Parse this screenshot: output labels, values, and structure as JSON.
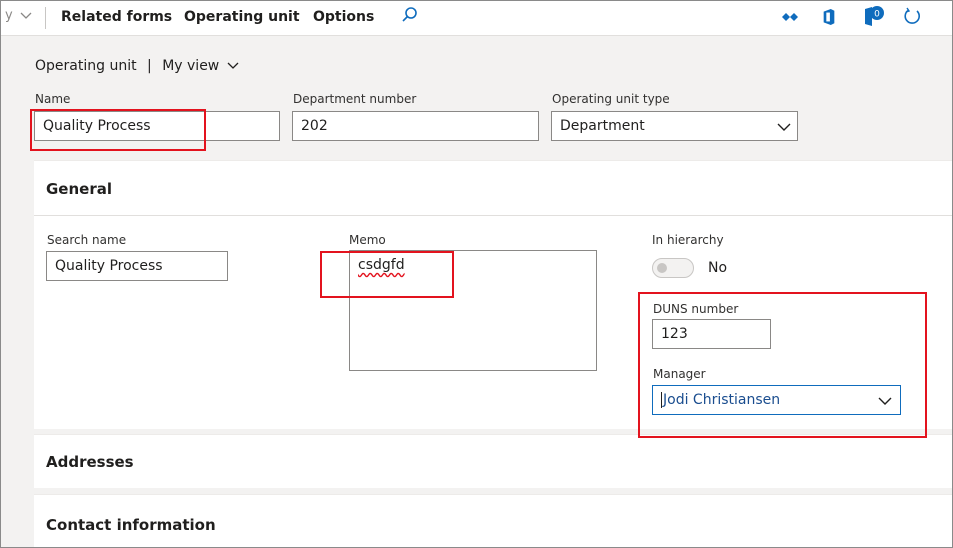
{
  "toolbar": {
    "cut_glyph": "y",
    "items": [
      "Related forms",
      "Operating unit",
      "Options"
    ],
    "icons": [
      "chevron-down-icon",
      "search-icon",
      "diamond-icon",
      "office-icon",
      "badge-icon",
      "refresh-icon"
    ],
    "badge_count": "0"
  },
  "header": {
    "title": "Operating unit",
    "separator": "|",
    "view": "My view"
  },
  "fields": {
    "name": {
      "label": "Name",
      "value": "Quality Process"
    },
    "department_number": {
      "label": "Department number",
      "value": "202"
    },
    "operating_unit_type": {
      "label": "Operating unit type",
      "value": "Department"
    }
  },
  "general": {
    "title": "General",
    "search_name": {
      "label": "Search name",
      "value": "Quality Process"
    },
    "memo": {
      "label": "Memo",
      "value": "csdgfd"
    },
    "in_hierarchy": {
      "label": "In hierarchy",
      "value": "No",
      "on": false
    },
    "duns_number": {
      "label": "DUNS number",
      "value": "123"
    },
    "manager": {
      "label": "Manager",
      "value": "Jodi Christiansen"
    }
  },
  "sections": {
    "addresses": "Addresses",
    "contact_information": "Contact information"
  },
  "colors": {
    "highlight": "#e3131e",
    "accent": "#0f6cbd",
    "link_text": "#1a4d8f"
  }
}
